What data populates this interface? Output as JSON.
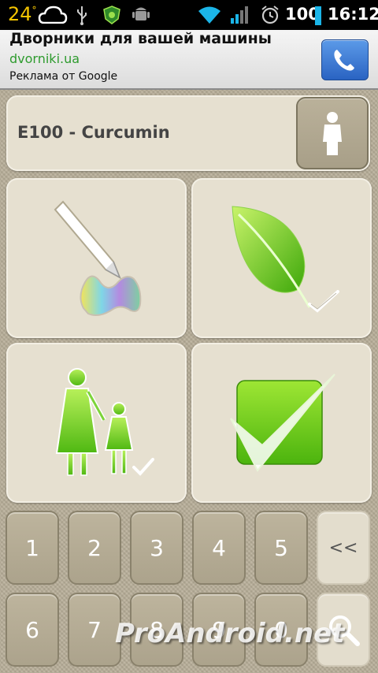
{
  "status_bar": {
    "temperature": "24",
    "temperature_unit": "°",
    "battery": "100",
    "time": "16:12",
    "icons": [
      "cloud-icon",
      "usb-icon",
      "antivirus-icon",
      "android-debug-icon",
      "wifi-icon",
      "signal-icon",
      "alarm-icon",
      "battery-icon"
    ]
  },
  "ad": {
    "title": "Дворники для вашей машины",
    "url": "dvorniki.ua",
    "by": "Реклама от Google",
    "call_icon": "phone-icon"
  },
  "header": {
    "title": "E100 - Curcumin",
    "profile_icon": "person-icon"
  },
  "tiles": [
    {
      "name": "coloring-tile",
      "icon": "pencil-color-icon"
    },
    {
      "name": "natural-tile",
      "icon": "leaf-check-icon"
    },
    {
      "name": "children-tile",
      "icon": "mother-child-check-icon"
    },
    {
      "name": "approved-tile",
      "icon": "green-checkbox-icon"
    }
  ],
  "keypad": {
    "row1": [
      "1",
      "2",
      "3",
      "4",
      "5",
      "<<"
    ],
    "row2": [
      "6",
      "7",
      "8",
      "9",
      "0"
    ],
    "search_icon": "search-icon"
  },
  "watermark": "ProAndroid.net",
  "colors": {
    "background": "#b8af99",
    "panel": "#e6e0d0",
    "key": "#b3aa93",
    "green": "#5fc21a",
    "ad_url": "#2e9b2e",
    "call_button": "#3a7bd5"
  }
}
